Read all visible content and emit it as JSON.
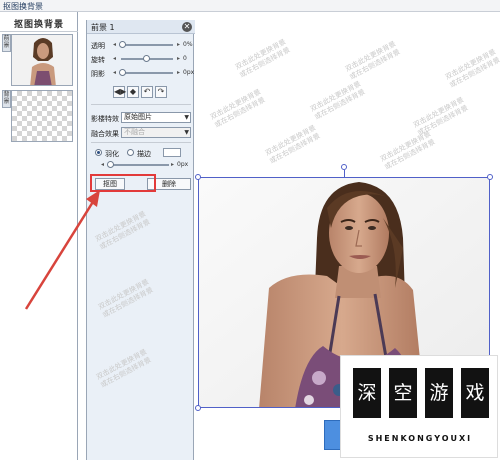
{
  "window": {
    "title": "抠图换背景"
  },
  "layers_panel": {
    "title": "抠图换背景",
    "layers": [
      {
        "tab": "前景"
      },
      {
        "tab": "背景"
      }
    ]
  },
  "properties": {
    "title": "前景 1",
    "opacity": {
      "label": "透明",
      "value": "0%"
    },
    "rotate": {
      "label": "旋转",
      "value": "0"
    },
    "shadow": {
      "label": "阴影",
      "value": "0px"
    },
    "tools": [
      {
        "icon": "flip-horizontal-icon",
        "glyph": "◀▶"
      },
      {
        "icon": "flip-vertical-icon",
        "glyph": "◆"
      },
      {
        "icon": "rotate-left-icon",
        "glyph": "↶"
      },
      {
        "icon": "rotate-right-icon",
        "glyph": "↷"
      }
    ],
    "effect": {
      "label": "影楼特效",
      "value": "原始图片"
    },
    "blend": {
      "label": "融合效果",
      "value": "不融合"
    },
    "feather": {
      "label": "羽化",
      "selected": true
    },
    "edge": {
      "label": "描边",
      "selected": false
    },
    "feather_value": "0px",
    "cutout_button": "抠图",
    "delete_button": "删除"
  },
  "watermark": {
    "line1": "双击此处更换背景",
    "line2": "或在右侧选择背景"
  },
  "badge": {
    "chars": [
      "深",
      "空",
      "游",
      "戏"
    ],
    "text": "SHENKONGYOUXI"
  },
  "colors": {
    "selection": "#5060c8",
    "highlight": "#e23a3a",
    "arrow": "#d8443c"
  }
}
